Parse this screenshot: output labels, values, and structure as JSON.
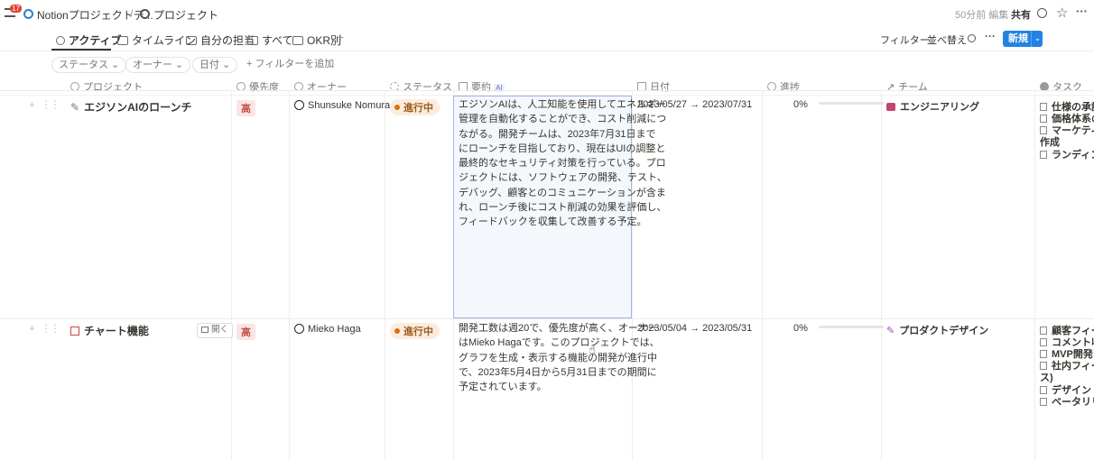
{
  "topbar": {
    "notif_count": "17",
    "workspace": "Notionプロジェクトデ...",
    "separator": "/",
    "page": "プロジェクト",
    "edited": "50分前 編集",
    "share": "共有"
  },
  "tabs": [
    "アクティブ",
    "タイムライン",
    "自分の担当",
    "すべて",
    "OKR別"
  ],
  "toolbar": {
    "filter": "フィルター",
    "sort": "並べ替え",
    "new": "新規"
  },
  "filters": {
    "status": "ステータス",
    "owner": "オーナー",
    "date": "日付",
    "add": "+ フィルターを追加"
  },
  "columns": {
    "project": "プロジェクト",
    "priority": "優先度",
    "owner": "オーナー",
    "status": "ステータス",
    "summary": "要約",
    "ai": "AI",
    "date": "日付",
    "progress": "進捗",
    "team": "チーム",
    "tasks": "タスク"
  },
  "rows": [
    {
      "name": "エジソンAIのローンチ",
      "priority": "高",
      "owner": "Shunsuke Nomura",
      "status": "進行中",
      "summary": [
        "エジソンAIは、人工知能を使用してエネルギー",
        "管理を自動化することができ、コスト削減につ",
        "ながる。開発チームは、2023年7月31日まで",
        "にローンチを目指しており、現在はUIの調整と",
        "最終的なセキュリティ対策を行っている。プロ",
        "ジェクトには、ソフトウェアの開発、テスト、",
        "デバッグ、顧客とのコミュニケーションが含ま",
        "れ、ローンチ後にコスト削減の効果を評価し、",
        "フィードバックを収集して改善する予定。"
      ],
      "date": "2023/05/27 → 2023/07/31",
      "progress": "0%",
      "progress_value": 0,
      "team": "エンジニアリング",
      "tasks": [
        "仕様の承認",
        "価格体系の",
        "マーケティ",
        "作成",
        "ランディン"
      ]
    },
    {
      "name": "チャート機能",
      "open": "開く",
      "priority": "高",
      "owner": "Mieko Haga",
      "status": "進行中",
      "summary": [
        "開発工数は週20で、優先度が高く、オーナー",
        "はMieko Hagaです。このプロジェクトでは、",
        "グラフを生成・表示する機能の開発が進行中",
        "で、2023年5月4日から5月31日までの期間に",
        "予定されています。"
      ],
      "date": "2023/05/04 → 2023/05/31",
      "progress": "0%",
      "progress_value": 0,
      "team": "プロダクトデザイン",
      "tasks": [
        "顧客フィー",
        "コメント収",
        "MVP開発",
        "社内フィー",
        "ス)",
        "デザイン・",
        "ベータリリ"
      ]
    }
  ]
}
